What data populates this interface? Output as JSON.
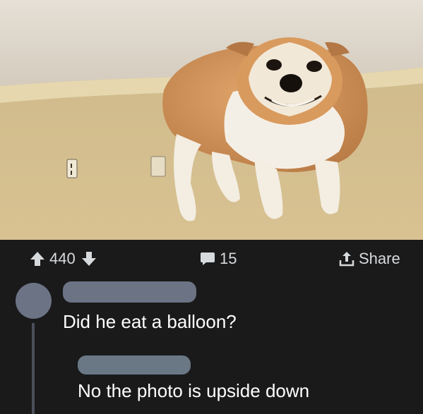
{
  "post": {
    "upvote_icon": "arrow-up-icon",
    "downvote_icon": "arrow-down-icon",
    "vote_count": "440",
    "comment_icon": "comment-bubble-icon",
    "comment_count": "15",
    "share_icon": "share-icon",
    "share_label": "Share"
  },
  "comments": [
    {
      "text": "Did he eat a balloon?"
    },
    {
      "text": "No the photo is upside down"
    }
  ],
  "colors": {
    "background": "#1a1a1b",
    "text": "#ffffff",
    "muted": "#d7dadc",
    "avatar": "#6b7384",
    "thread_line": "#4a4f5a"
  }
}
